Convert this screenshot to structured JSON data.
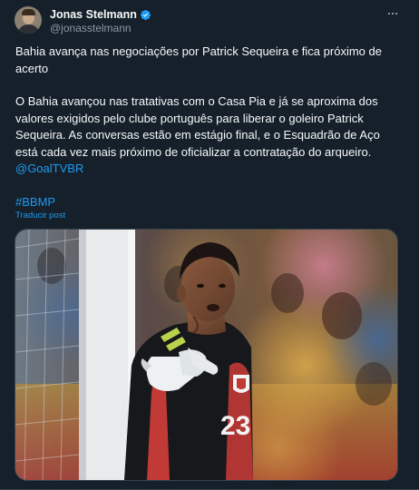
{
  "author": {
    "display_name": "Jonas Stelmann",
    "handle": "@jonasstelmann",
    "verified": true,
    "avatar_icon": "user-avatar"
  },
  "tweet": {
    "headline": "Bahia avança nas negociações por Patrick Sequeira e fica próximo de acerto",
    "body": "O Bahia avançou nas tratativas com o Casa Pia e já se aproxima dos valores exigidos pelo clube português para liberar o goleiro Patrick Sequeira. As conversas estão em estágio final, e o Esquadrão de Aço está cada vez mais próximo de oficializar a contratação do arqueiro.",
    "mention": "@GoalTVBR",
    "hashtag": "#BBMP",
    "translate_label": "Traducir post"
  },
  "media": {
    "shirt_number": "23"
  },
  "colors": {
    "background": "#15202b",
    "link": "#1d9bf0",
    "muted": "#8b98a5",
    "border": "#38444d"
  }
}
